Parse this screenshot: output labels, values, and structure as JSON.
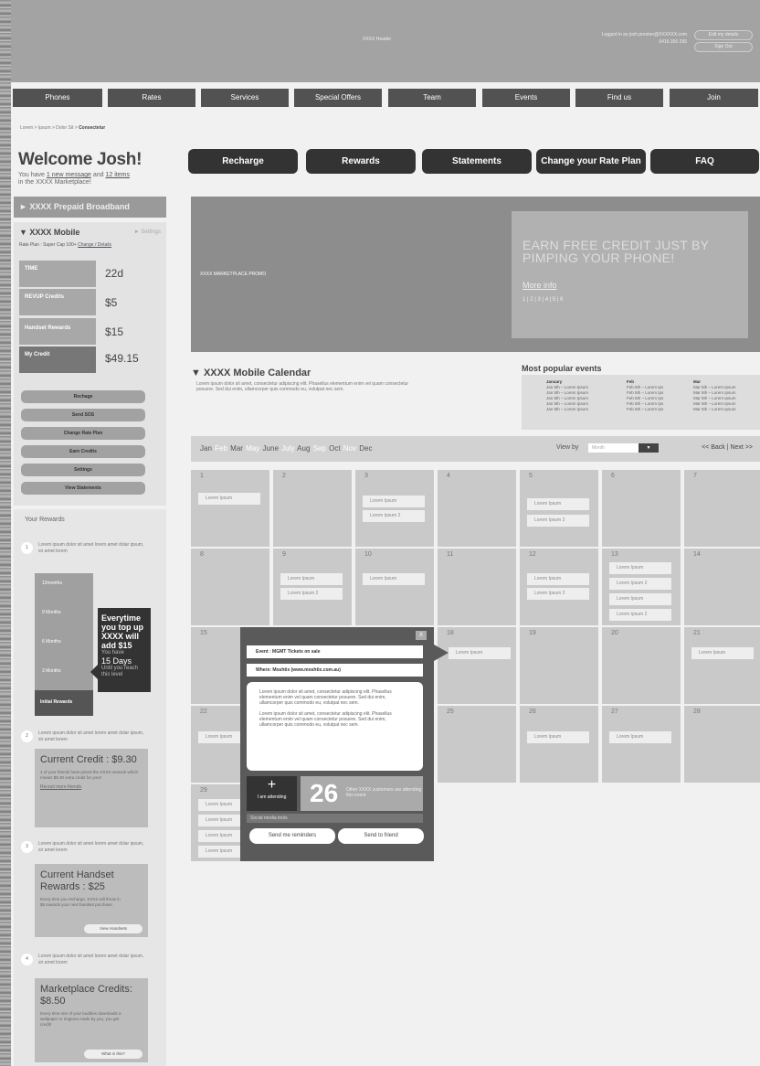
{
  "header": {
    "title": "XXXX Header",
    "login": "Logged in as josh.preston@XXXXXX.com",
    "phone": "0416 350 295",
    "edit_button": "Edit my details",
    "signout_button": "Sign Out"
  },
  "nav": [
    "Phones",
    "Rates",
    "Services",
    "Special Offers",
    "Team",
    "Events",
    "Find us",
    "Join"
  ],
  "breadcrumb": {
    "trail": "Lorem > Ipsum > Dolor Sit > ",
    "current": "Consectetur"
  },
  "welcome": {
    "title": "Welcome Josh!",
    "pre": "You have ",
    "messages": "1 new message",
    "mid": " and ",
    "items": "12 items",
    "post": "in the XXXX Marketplace!"
  },
  "broadband": "► XXXX Prepaid Broadband",
  "mobile": {
    "title": "▼ XXXX Mobile",
    "settings": "► Settings",
    "rate_plan": "Rate Plan : Super Cap 100+",
    "rate_links": "Change / Details",
    "stats": [
      {
        "label": "TIME",
        "value": "22d"
      },
      {
        "label": "REVUP Credits",
        "value": "$5"
      },
      {
        "label": "Handset Rewards",
        "value": "$15"
      },
      {
        "label": "My Credit",
        "value": "$49.15"
      }
    ],
    "actions": [
      "Rechage",
      "Send SOS",
      "Change Rate Plan",
      "Earn Credits",
      "Settings",
      "View Statements"
    ]
  },
  "rewards": {
    "title": "Your Rewards",
    "step_text": "Lorem ipsum dolor sit amet lorem amet dolar ipsum, sir amet lorem",
    "steps": [
      "1",
      "2",
      "3",
      "4"
    ],
    "ladder": [
      "12months",
      "9 Months",
      "6 Months",
      "3 Months"
    ],
    "initial": "Initial Rewards",
    "tip_big": "Everytime you top up XXXX will add $15",
    "tip_sm1": "You have",
    "tip_md": "15 Days",
    "tip_sm2": "Until you reach this level",
    "card1": {
      "title": "Current Credit : $9.30",
      "text": "4 of your friends have joined the XXXX network which means $9.30 extra credit for you!!",
      "link": "Recruit more friends"
    },
    "card2": {
      "title": "Current Handset Rewards : $25",
      "text": "Every time you recharge, XXXX will throw in $5 towards your next handset purchase",
      "button": "View Handsets"
    },
    "card3": {
      "title": "Marketplace Credits: $8.50",
      "text": "Every time one of your buddies downloads a wallpaper or ringtone made by you, you get credit!",
      "button": "What is this?"
    }
  },
  "main_nav": [
    "Recharge",
    "Rewards",
    "Statements",
    "Change your Rate Plan",
    "FAQ"
  ],
  "promo": {
    "label": "XXXX MARKETPLACE PROMO",
    "headline": "EARN FREE CREDIT JUST BY PIMPING YOUR PHONE!",
    "more": "More info",
    "pages": "1 | 2 | 3 | 4 | 5 | 6"
  },
  "calendar": {
    "title": "▼ XXXX Mobile Calendar",
    "desc": "Lorem ipsum dolor sit amet, consectetur adipiscing elit. Phasellus elementum enim vel quam consectetur posuere. Sed dui enim, ullamcorper quis commodo eu, volutpat nec sem.",
    "months": [
      "Jan",
      "Feb",
      "Mar",
      "May",
      "June",
      "July",
      "Aug",
      "Sep",
      "Oct",
      "Nov",
      "Dec"
    ],
    "view_by": "View by",
    "view_value": "Month",
    "back_next": "<< Back | Next >>",
    "days": [
      "1",
      "2",
      "3",
      "4",
      "5",
      "6",
      "7",
      "8",
      "9",
      "10",
      "11",
      "12",
      "13",
      "14",
      "15",
      "16",
      "17",
      "18",
      "19",
      "20",
      "21",
      "22",
      "23",
      "24",
      "25",
      "26",
      "27",
      "28",
      "29"
    ],
    "ev1": "Lorem Ipsum",
    "ev2": "Lorem Ipsum 2"
  },
  "popular": {
    "title": "Most popular events",
    "cols": [
      {
        "month": "January",
        "lines": [
          "Jan 5th – Lorem Ipsum",
          "Jan 5th – Lorem Ipsum",
          "Jan 5th – Lorem Ipsum",
          "Jan 5th – Lorem Ipsum",
          "Jan 5th – Lorem Ipsum"
        ]
      },
      {
        "month": "Feb",
        "lines": [
          "Feb 5th – Lorem Ips",
          "Feb 5th – Lorem Ips",
          "Feb 5th – Lorem Ips",
          "Feb 5th – Lorem Ips",
          "Feb 5th – Lorem Ips"
        ]
      },
      {
        "month": "Mar",
        "lines": [
          "Mar 5th – Lorem Ipsum",
          "Mar 5th – Lorem Ipsum",
          "Mar 5th – Lorem Ipsum",
          "Mar 5th – Lorem Ipsum",
          "Mar 5th – Lorem Ipsum"
        ]
      }
    ]
  },
  "modal": {
    "close": "X",
    "event": "Event : MGMT Tickets on sale",
    "where": "Where: Moshtix (www.moshtix.com.au)",
    "body": "Lorem ipsum dolor sit amet, consectetur adipiscing elit. Phasellus elementum enim vel quam consectetur posuere. Sed dui enim, ullamcorper quis commodo eu, volutpat nec sem.",
    "plus": "+",
    "attending": "I am attending",
    "count": "26",
    "others": "Other XXXX customers are attending this event",
    "social": "Social media tools",
    "reminders": "Send me reminders",
    "friend": "Send to friend"
  }
}
